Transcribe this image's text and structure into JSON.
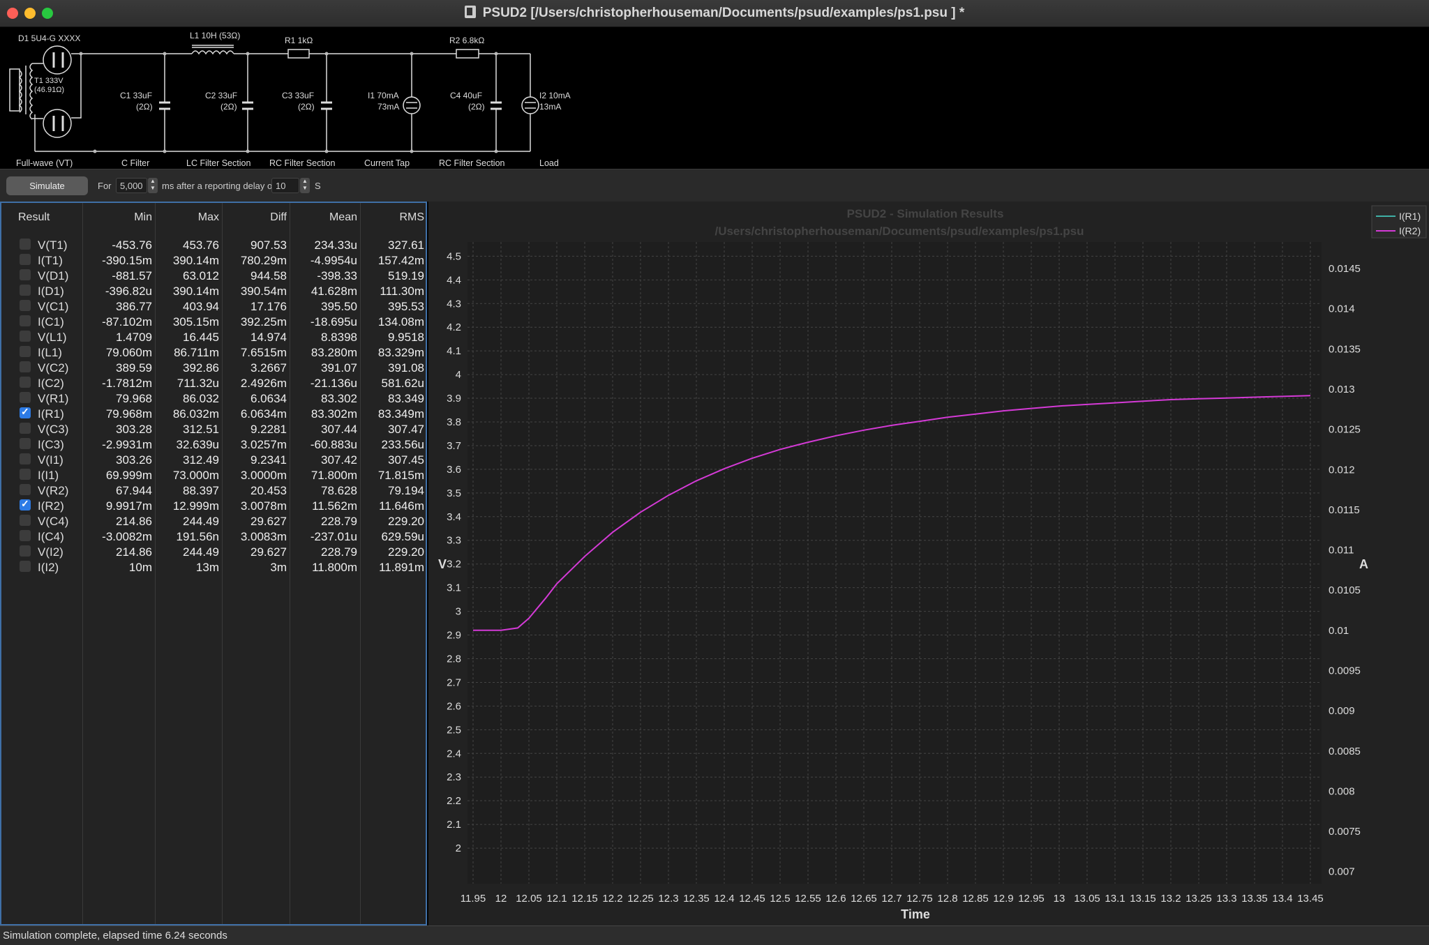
{
  "window": {
    "title": "PSUD2  [/Users/christopherhouseman/Documents/psud/examples/ps1.psu ] *",
    "light_colors": [
      "#fe5f57",
      "#febc2e",
      "#28c840"
    ]
  },
  "schematic": {
    "components": {
      "d1": "D1 5U4-G XXXX",
      "t1_a": "T1 333V",
      "t1_b": "(46.91Ω)",
      "l1": "L1 10H (53Ω)",
      "r1": "R1 1kΩ",
      "r2": "R2 6.8kΩ",
      "c1_a": "C1 33uF",
      "c1_b": "(2Ω)",
      "c2_a": "C2 33uF",
      "c2_b": "(2Ω)",
      "c3_a": "C3 33uF",
      "c3_b": "(2Ω)",
      "i1_a": "I1 70mA",
      "i1_b": "73mA",
      "c4_a": "C4 40uF",
      "c4_b": "(2Ω)",
      "i2_a": "I2 10mA",
      "i2_b": "13mA"
    },
    "sections": [
      "Full-wave (VT)",
      "C Filter",
      "LC Filter Section",
      "RC Filter Section",
      "Current Tap",
      "RC Filter Section",
      "Load"
    ]
  },
  "toolbar": {
    "simulate_label": "Simulate",
    "for_label": "For",
    "duration_value": "5,000",
    "delay_label": "ms after a reporting delay of",
    "delay_value": "10",
    "unit_label": "S"
  },
  "table": {
    "headers": [
      "Result",
      "Min",
      "Max",
      "Diff",
      "Mean",
      "RMS"
    ],
    "rows": [
      {
        "name": "V(T1)",
        "checked": false,
        "min": "-453.76",
        "max": "453.76",
        "diff": "907.53",
        "mean": "234.33u",
        "rms": "327.61"
      },
      {
        "name": "I(T1)",
        "checked": false,
        "min": "-390.15m",
        "max": "390.14m",
        "diff": "780.29m",
        "mean": "-4.9954u",
        "rms": "157.42m"
      },
      {
        "name": "V(D1)",
        "checked": false,
        "min": "-881.57",
        "max": "63.012",
        "diff": "944.58",
        "mean": "-398.33",
        "rms": "519.19"
      },
      {
        "name": "I(D1)",
        "checked": false,
        "min": "-396.82u",
        "max": "390.14m",
        "diff": "390.54m",
        "mean": "41.628m",
        "rms": "111.30m"
      },
      {
        "name": "V(C1)",
        "checked": false,
        "min": "386.77",
        "max": "403.94",
        "diff": "17.176",
        "mean": "395.50",
        "rms": "395.53"
      },
      {
        "name": "I(C1)",
        "checked": false,
        "min": "-87.102m",
        "max": "305.15m",
        "diff": "392.25m",
        "mean": "-18.695u",
        "rms": "134.08m"
      },
      {
        "name": "V(L1)",
        "checked": false,
        "min": "1.4709",
        "max": "16.445",
        "diff": "14.974",
        "mean": "8.8398",
        "rms": "9.9518"
      },
      {
        "name": "I(L1)",
        "checked": false,
        "min": "79.060m",
        "max": "86.711m",
        "diff": "7.6515m",
        "mean": "83.280m",
        "rms": "83.329m"
      },
      {
        "name": "V(C2)",
        "checked": false,
        "min": "389.59",
        "max": "392.86",
        "diff": "3.2667",
        "mean": "391.07",
        "rms": "391.08"
      },
      {
        "name": "I(C2)",
        "checked": false,
        "min": "-1.7812m",
        "max": "711.32u",
        "diff": "2.4926m",
        "mean": "-21.136u",
        "rms": "581.62u"
      },
      {
        "name": "V(R1)",
        "checked": false,
        "min": "79.968",
        "max": "86.032",
        "diff": "6.0634",
        "mean": "83.302",
        "rms": "83.349"
      },
      {
        "name": "I(R1)",
        "checked": true,
        "min": "79.968m",
        "max": "86.032m",
        "diff": "6.0634m",
        "mean": "83.302m",
        "rms": "83.349m"
      },
      {
        "name": "V(C3)",
        "checked": false,
        "min": "303.28",
        "max": "312.51",
        "diff": "9.2281",
        "mean": "307.44",
        "rms": "307.47"
      },
      {
        "name": "I(C3)",
        "checked": false,
        "min": "-2.9931m",
        "max": "32.639u",
        "diff": "3.0257m",
        "mean": "-60.883u",
        "rms": "233.56u"
      },
      {
        "name": "V(I1)",
        "checked": false,
        "min": "303.26",
        "max": "312.49",
        "diff": "9.2341",
        "mean": "307.42",
        "rms": "307.45"
      },
      {
        "name": "I(I1)",
        "checked": false,
        "min": "69.999m",
        "max": "73.000m",
        "diff": "3.0000m",
        "mean": "71.800m",
        "rms": "71.815m"
      },
      {
        "name": "V(R2)",
        "checked": false,
        "min": "67.944",
        "max": "88.397",
        "diff": "20.453",
        "mean": "78.628",
        "rms": "79.194"
      },
      {
        "name": "I(R2)",
        "checked": true,
        "min": "9.9917m",
        "max": "12.999m",
        "diff": "3.0078m",
        "mean": "11.562m",
        "rms": "11.646m"
      },
      {
        "name": "V(C4)",
        "checked": false,
        "min": "214.86",
        "max": "244.49",
        "diff": "29.627",
        "mean": "228.79",
        "rms": "229.20"
      },
      {
        "name": "I(C4)",
        "checked": false,
        "min": "-3.0082m",
        "max": "191.56n",
        "diff": "3.0083m",
        "mean": "-237.01u",
        "rms": "629.59u"
      },
      {
        "name": "V(I2)",
        "checked": false,
        "min": "214.86",
        "max": "244.49",
        "diff": "29.627",
        "mean": "228.79",
        "rms": "229.20"
      },
      {
        "name": "I(I2)",
        "checked": false,
        "min": "10m",
        "max": "13m",
        "diff": "3m",
        "mean": "11.800m",
        "rms": "11.891m"
      }
    ]
  },
  "chart_data": {
    "type": "line",
    "title": "PSUD2 - Simulation Results",
    "subtitle": "/Users/christopherhouseman/Documents/psud/examples/ps1.psu",
    "xlabel": "Time",
    "ylabel_left": "V",
    "ylabel_right": "A",
    "xlim": [
      11.94,
      13.47
    ],
    "ylim_left": [
      1.85,
      4.56
    ],
    "ylim_right": [
      0.00685,
      0.01483
    ],
    "x_ticks": [
      11.95,
      12,
      12.05,
      12.1,
      12.15,
      12.2,
      12.25,
      12.3,
      12.35,
      12.4,
      12.45,
      12.5,
      12.55,
      12.6,
      12.65,
      12.7,
      12.75,
      12.8,
      12.85,
      12.9,
      12.95,
      13,
      13.05,
      13.1,
      13.15,
      13.2,
      13.25,
      13.3,
      13.35,
      13.4,
      13.45
    ],
    "x_tick_labels": [
      "11.95",
      "12",
      "12.05",
      "12.1",
      "12.15",
      "12.2",
      "12.25",
      "12.3",
      "12.35",
      "12.4",
      "12.45",
      "12.5",
      "12.55",
      "12.6",
      "12.65",
      "12.7",
      "12.75",
      "12.8",
      "12.85",
      "12.9",
      "12.95",
      "13",
      "13.05",
      "13.1",
      "13.15",
      "13.2",
      "13.25",
      "13.3",
      "13.35",
      "13.4",
      "13.45"
    ],
    "y_left_ticks": [
      2,
      2.1,
      2.2,
      2.3,
      2.4,
      2.5,
      2.6,
      2.7,
      2.8,
      2.9,
      3,
      3.1,
      3.2,
      3.3,
      3.4,
      3.5,
      3.6,
      3.7,
      3.8,
      3.9,
      4,
      4.1,
      4.2,
      4.3,
      4.4,
      4.5
    ],
    "y_left_tick_labels": [
      "2",
      "2.1",
      "2.2",
      "2.3",
      "2.4",
      "2.5",
      "2.6",
      "2.7",
      "2.8",
      "2.9",
      "3",
      "3.1",
      "3.2",
      "3.3",
      "3.4",
      "3.5",
      "3.6",
      "3.7",
      "3.8",
      "3.9",
      "4",
      "4.1",
      "4.2",
      "4.3",
      "4.4",
      "4.5"
    ],
    "y_right_ticks": [
      0.007,
      0.0075,
      0.008,
      0.0085,
      0.009,
      0.0095,
      0.01,
      0.0105,
      0.011,
      0.0115,
      0.012,
      0.0125,
      0.013,
      0.0135,
      0.014,
      0.0145
    ],
    "y_right_tick_labels": [
      "0.007",
      "0.0075",
      "0.008",
      "0.0085",
      "0.009",
      "0.0095",
      "0.01",
      "0.0105",
      "0.011",
      "0.0115",
      "0.012",
      "0.0125",
      "0.013",
      "0.0135",
      "0.014",
      "0.0145"
    ],
    "grid": true,
    "legend_position": "top-right",
    "series": [
      {
        "name": "I(R1)",
        "axis": "right",
        "color": "#3fb0a6",
        "x": [],
        "y": []
      },
      {
        "name": "I(R2)",
        "axis": "right",
        "color": "#d43ad6",
        "x": [
          11.95,
          12.0,
          12.03,
          12.05,
          12.08,
          12.1,
          12.15,
          12.2,
          12.25,
          12.3,
          12.35,
          12.4,
          12.45,
          12.5,
          12.55,
          12.6,
          12.65,
          12.7,
          12.75,
          12.8,
          12.85,
          12.9,
          12.95,
          13.0,
          13.05,
          13.1,
          13.15,
          13.2,
          13.25,
          13.3,
          13.35,
          13.4,
          13.45
        ],
        "y": [
          0.01,
          0.01,
          0.01003,
          0.01015,
          0.0104,
          0.01058,
          0.01092,
          0.01122,
          0.01147,
          0.01168,
          0.01186,
          0.01201,
          0.01214,
          0.01225,
          0.01234,
          0.01242,
          0.01249,
          0.01255,
          0.0126,
          0.01265,
          0.01269,
          0.01273,
          0.01276,
          0.01279,
          0.01281,
          0.01283,
          0.01285,
          0.01287,
          0.01288,
          0.01289,
          0.0129,
          0.01291,
          0.01292
        ]
      }
    ]
  },
  "status": {
    "text": "Simulation complete, elapsed time 6.24 seconds"
  }
}
